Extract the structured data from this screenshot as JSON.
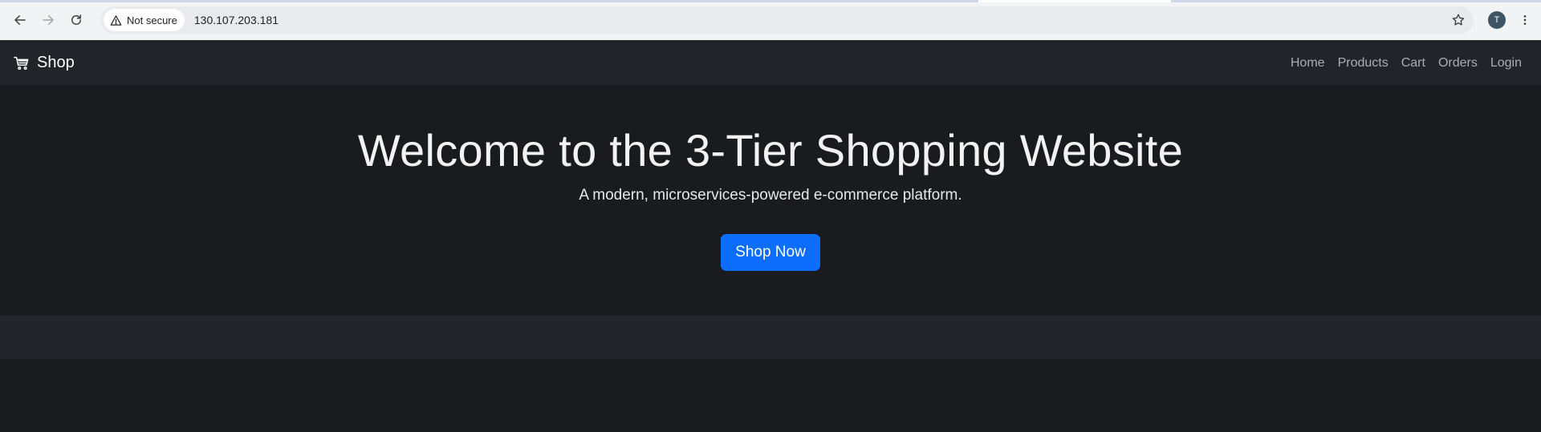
{
  "browser": {
    "security_label": "Not secure",
    "url": "130.107.203.181",
    "profile_initial": "T"
  },
  "navbar": {
    "brand": "Shop",
    "links": [
      "Home",
      "Products",
      "Cart",
      "Orders",
      "Login"
    ]
  },
  "hero": {
    "title": "Welcome to the 3-Tier Shopping Website",
    "subtitle": "A modern, microservices-powered e-commerce platform.",
    "cta_label": "Shop Now"
  },
  "colors": {
    "navbar_bg": "#212429",
    "page_bg": "#1a1b1e",
    "accent": "#0d6efd"
  }
}
